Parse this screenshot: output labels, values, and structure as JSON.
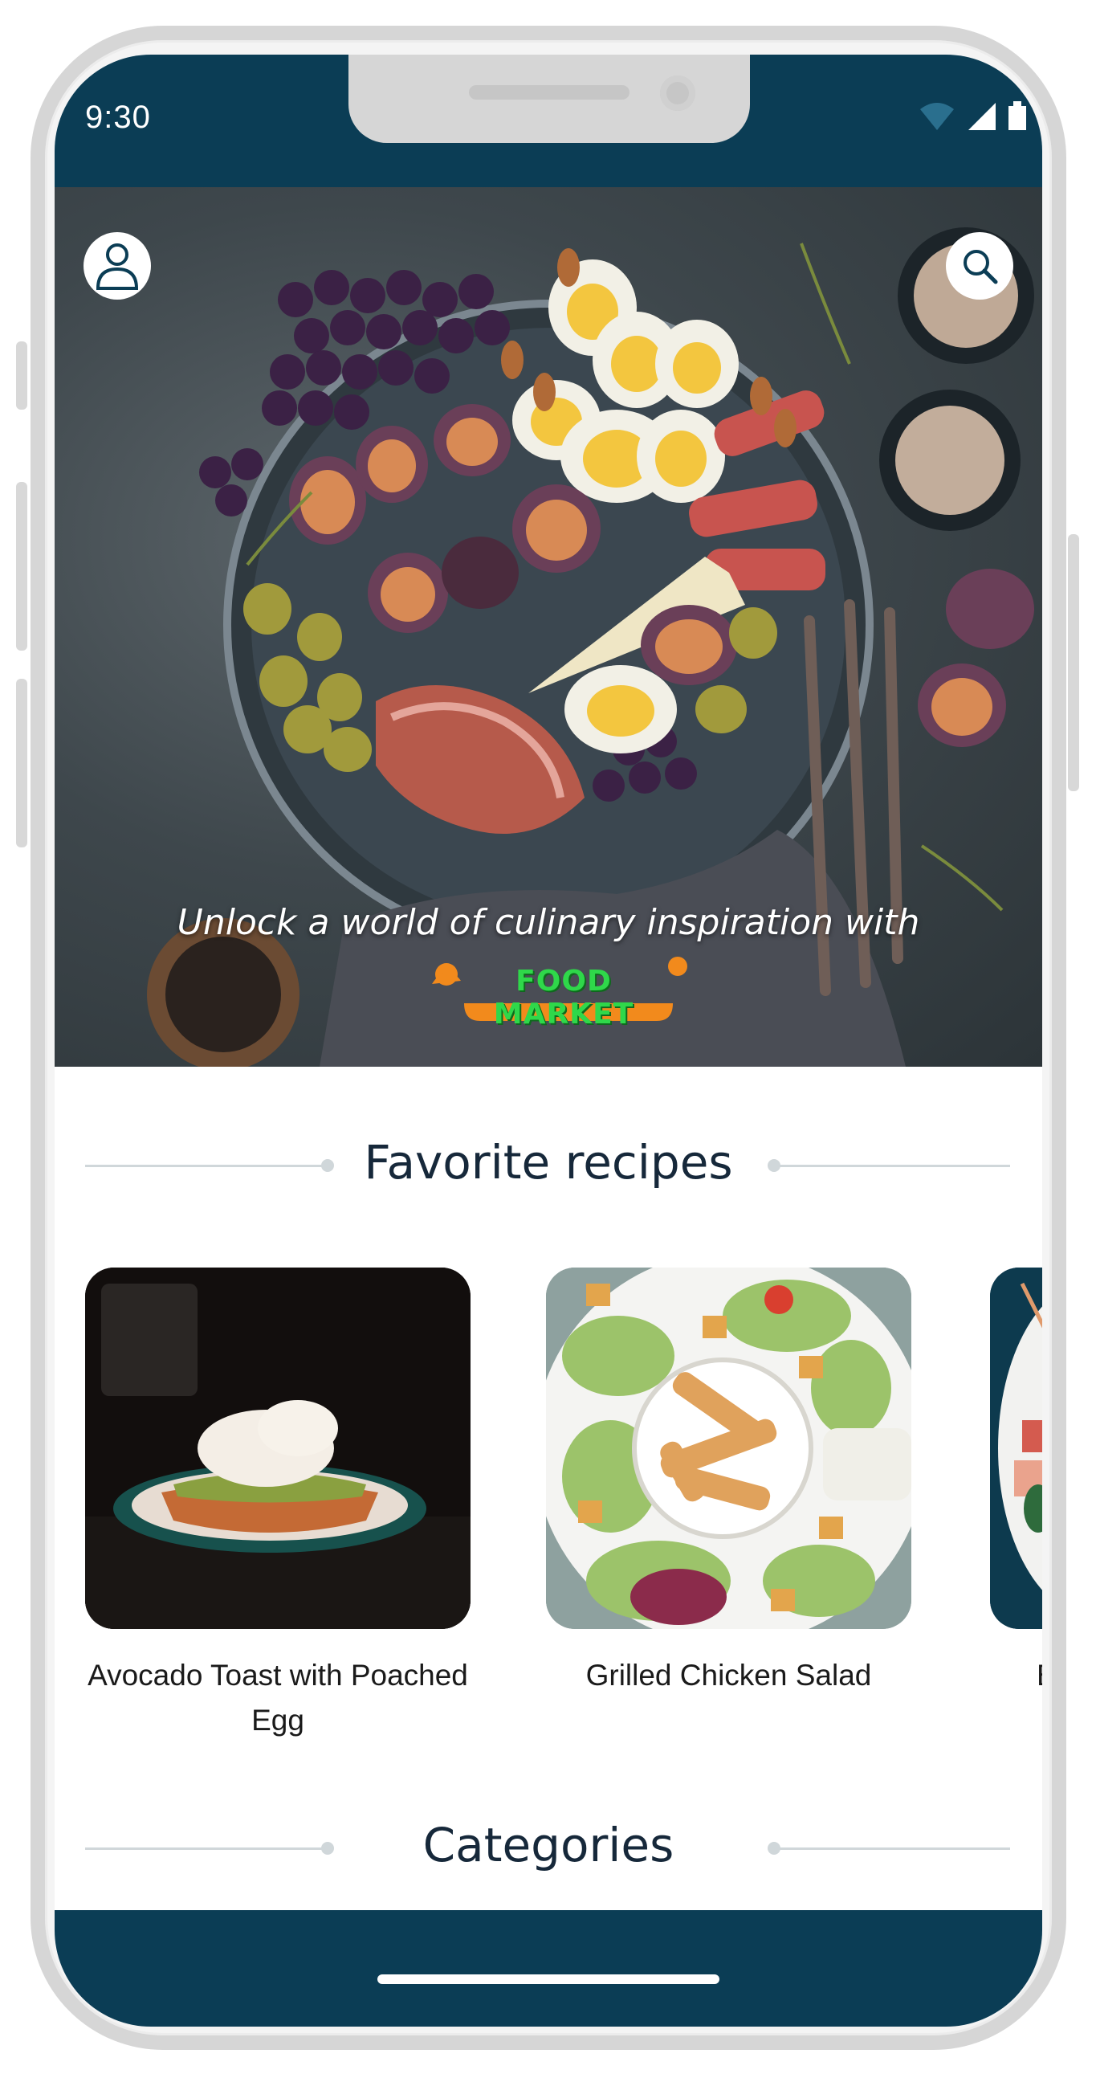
{
  "status_bar": {
    "time": "9:30"
  },
  "hero": {
    "tagline": "Unlock a world of culinary inspiration with",
    "brand": "FOOD MARKET"
  },
  "sections": {
    "favorites_title": "Favorite recipes",
    "categories_title": "Categories"
  },
  "recipes": [
    {
      "name": "Avocado Toast with Poached Egg"
    },
    {
      "name": "Grilled Chicken Salad"
    },
    {
      "name": "B"
    }
  ],
  "colors": {
    "brand_dark": "#0b3d55",
    "logo_orange": "#f28a1c",
    "logo_green": "#2fd84a"
  },
  "icons": [
    "user-icon",
    "search-icon",
    "wifi-icon",
    "signal-icon",
    "battery-icon"
  ]
}
